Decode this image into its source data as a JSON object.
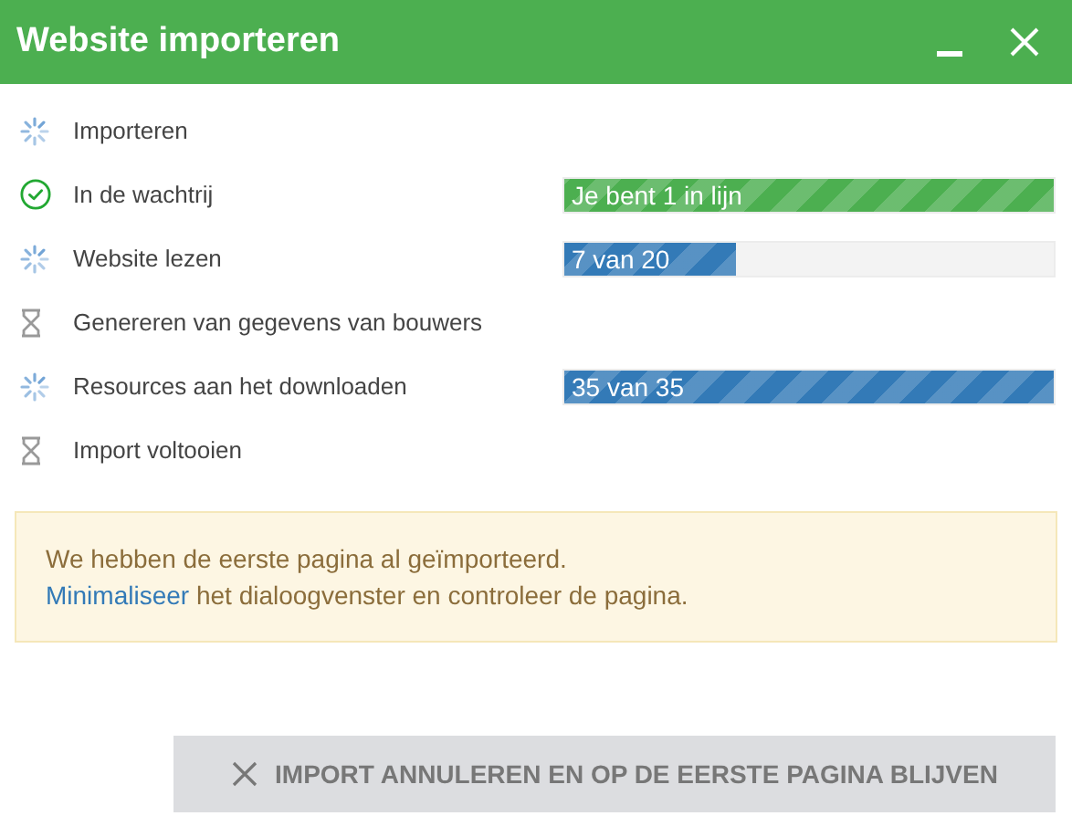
{
  "window": {
    "title": "Website importeren"
  },
  "steps": [
    {
      "label": "Importeren",
      "kind": "loading"
    },
    {
      "label": "In de wachtrij",
      "kind": "done",
      "progress": {
        "text": "Je bent 1 in lijn",
        "level": 1,
        "color": "#4caf50"
      }
    },
    {
      "label": "Website lezen",
      "kind": "loading",
      "progress": {
        "text": "7 van 20",
        "level": 0.35,
        "color": "#337ab7"
      }
    },
    {
      "label": "Genereren van gegevens van bouwers",
      "kind": "waiting"
    },
    {
      "label": "Resources aan het downloaden",
      "kind": "loading",
      "progress": {
        "text": "35 van 35",
        "level": 1,
        "color": "#337ab7"
      }
    },
    {
      "label": "Import voltooien",
      "kind": "waiting"
    }
  ],
  "notice": {
    "line_1": "We hebben de eerste pagina al geïmporteerd.",
    "link": "Minimaliseer",
    "line_2": "het dialoogvenster en controleer de pagina."
  },
  "cancel_button": {
    "label": "IMPORT ANNULEREN EN OP DE EERSTE PAGINA BLIJVEN"
  }
}
